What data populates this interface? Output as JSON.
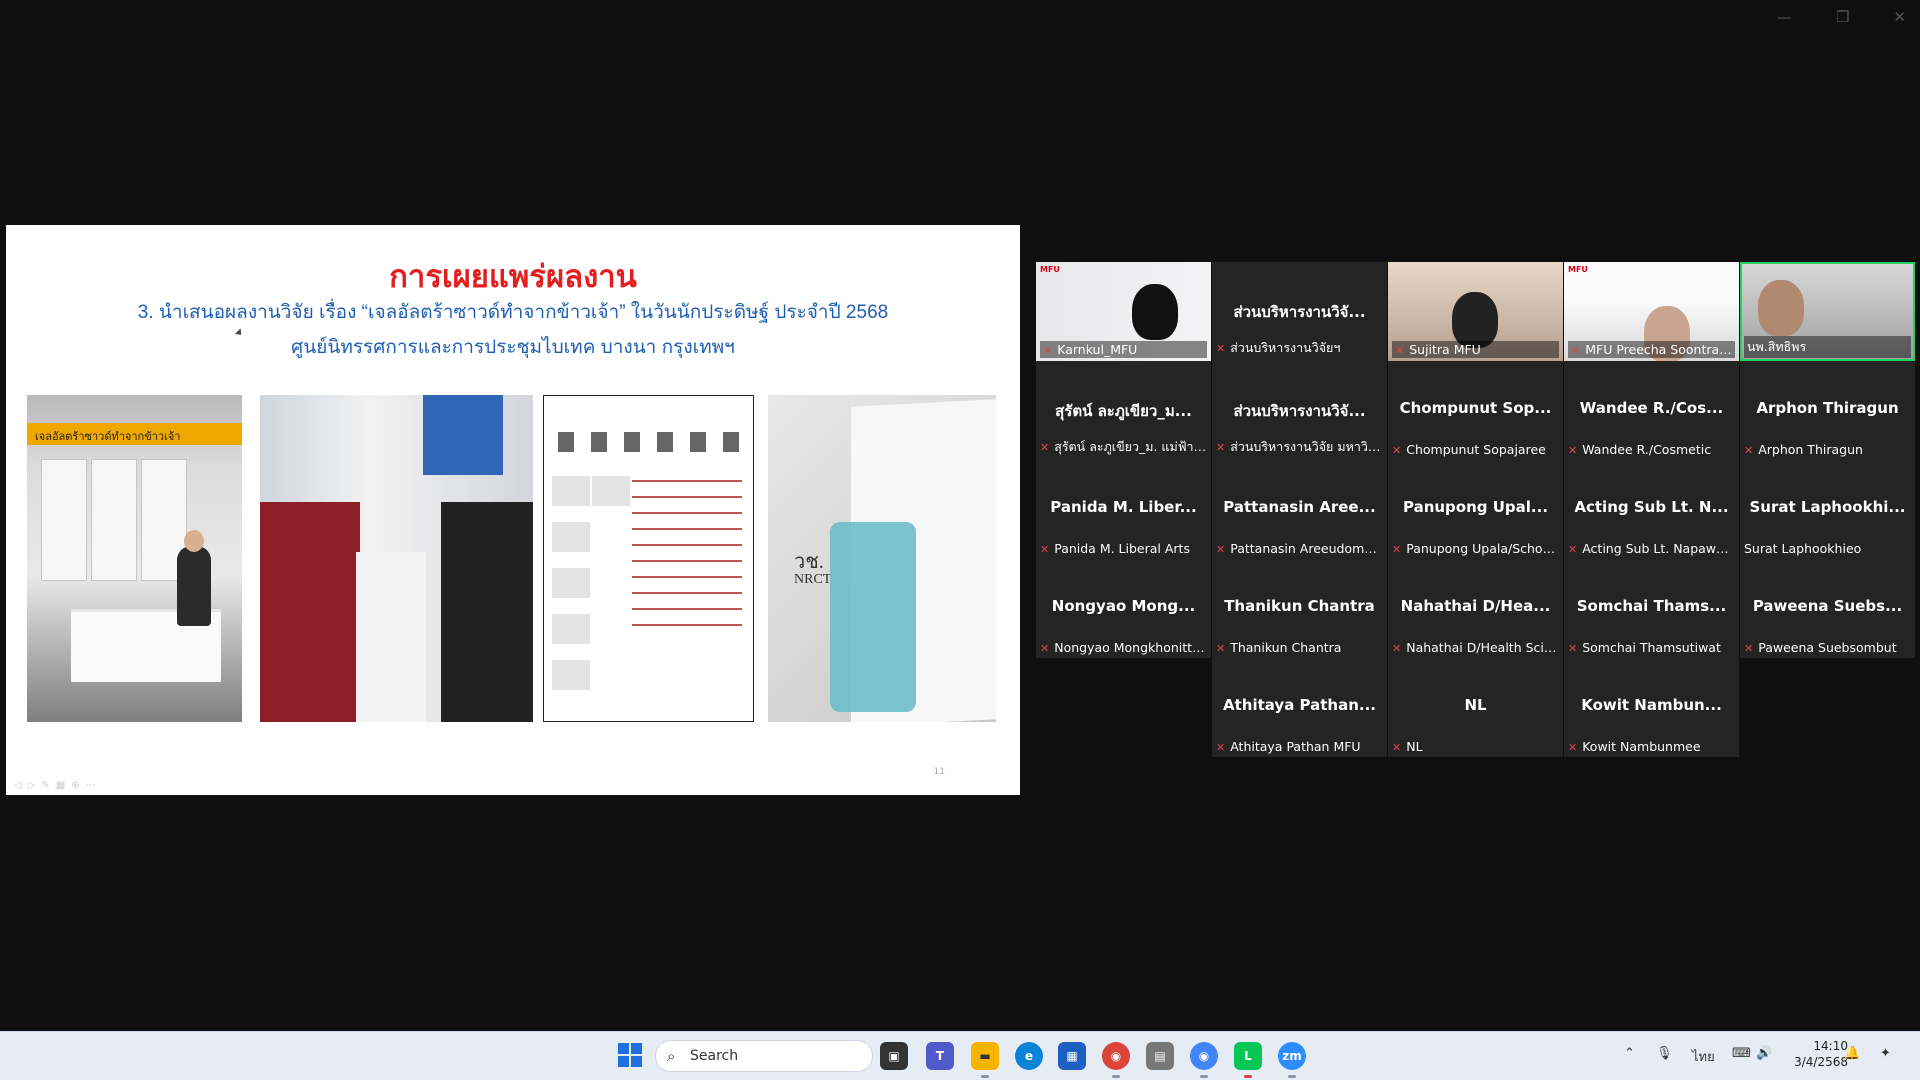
{
  "slide": {
    "title": "การเผยแพร่ผลงาน",
    "line1": "3. นำเสนอผลงานวิจัย เรื่อง “เจลอัลตร้าซาวด์ทำจากข้าวเจ้า” ในวันนักประดิษฐ์ ประจำปี 2568",
    "line2": "ศูนย์นิทรรศการและการประชุมไบเทค บางนา กรุงเทพฯ",
    "photo1_banner": "เจลอัลตร้าซาวด์ทำจากข้าวเจ้า",
    "photo4_logo": "วช.",
    "photo4_logo_sub": "NRCT",
    "page_number": "11"
  },
  "participants": [
    {
      "display": "",
      "name": "Karnkul_MFU",
      "video": true,
      "muted": true,
      "logo": "MFU"
    },
    {
      "display": "ส่วนบริหารงานวิจั...",
      "name": "ส่วนบริหารงานวิจัยฯ",
      "video": false,
      "muted": true
    },
    {
      "display": "",
      "name": "Sujitra MFU",
      "video": true,
      "muted": true
    },
    {
      "display": "",
      "name": "MFU Preecha Soontranan",
      "video": true,
      "muted": true,
      "logo": "MFU"
    },
    {
      "display": "",
      "name": "นพ.สิทธิพร",
      "video": true,
      "muted": false,
      "active": true
    },
    {
      "display": "สุรัตน์ ละภูเขียว_ม...",
      "name": "สุรัตน์ ละภูเขียว_ม. แม่ฟ้าหลวง",
      "video": false,
      "muted": true
    },
    {
      "display": "ส่วนบริหารงานวิจั...",
      "name": "ส่วนบริหารงานวิจัย มหาวิทย...",
      "video": false,
      "muted": true
    },
    {
      "display": "Chompunut Sop...",
      "name": "Chompunut Sopajaree",
      "video": false,
      "muted": true
    },
    {
      "display": "Wandee R./Cos...",
      "name": "Wandee R./Cosmetic",
      "video": false,
      "muted": true
    },
    {
      "display": "Arphon Thiragun",
      "name": "Arphon Thiragun",
      "video": false,
      "muted": true
    },
    {
      "display": "Panida M. Liber...",
      "name": "Panida M. Liberal Arts",
      "video": false,
      "muted": true
    },
    {
      "display": "Pattanasin Aree...",
      "name": "Pattanasin Areeudomwo...",
      "video": false,
      "muted": true
    },
    {
      "display": "Panupong Upal...",
      "name": "Panupong Upala/School...",
      "video": false,
      "muted": true
    },
    {
      "display": "Acting Sub Lt. N...",
      "name": "Acting Sub Lt. Napawat ...",
      "video": false,
      "muted": true
    },
    {
      "display": "Surat Laphookhi...",
      "name": "Surat Laphookhieo",
      "video": false,
      "muted": false
    },
    {
      "display": "Nongyao Mong...",
      "name": "Nongyao Mongkhonittiv...",
      "video": false,
      "muted": true
    },
    {
      "display": "Thanikun Chantra",
      "name": "Thanikun Chantra",
      "video": false,
      "muted": true
    },
    {
      "display": "Nahathai D/Hea...",
      "name": "Nahathai D/Health Scien...",
      "video": false,
      "muted": true
    },
    {
      "display": "Somchai Thams...",
      "name": "Somchai Thamsutiwat",
      "video": false,
      "muted": true
    },
    {
      "display": "Paweena Suebs...",
      "name": "Paweena Suebsombut",
      "video": false,
      "muted": true
    },
    {
      "display": "Athitaya Pathan...",
      "name": "Athitaya Pathan MFU",
      "video": false,
      "muted": true
    },
    {
      "display": "NL",
      "name": "NL",
      "video": false,
      "muted": true
    },
    {
      "display": "Kowit Nambun...",
      "name": "Kowit Nambunmee",
      "video": false,
      "muted": true
    }
  ],
  "taskbar": {
    "search_placeholder": "Search",
    "language": "ไทย",
    "time": "14:10",
    "date": "3/4/2568"
  },
  "colors": {
    "title_red": "#e41e1e",
    "subtitle_blue": "#1f5fb3",
    "active_speaker": "#23d160",
    "muted_icon": "#e0454a"
  }
}
